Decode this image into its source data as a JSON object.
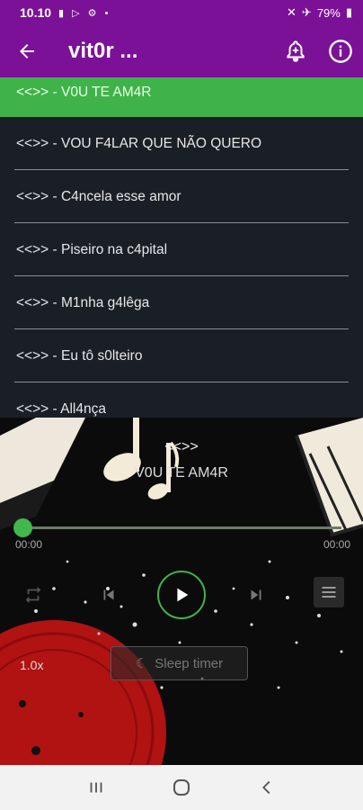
{
  "status": {
    "time": "10.10",
    "battery": "79%"
  },
  "app_bar": {
    "title": "vit0r ..."
  },
  "songs": [
    {
      "label": "<<>> - V0U TE AM4R",
      "active": true
    },
    {
      "label": "<<>> - VOU F4LAR QUE NÃO QUERO"
    },
    {
      "label": "<<>> - C4ncela esse amor"
    },
    {
      "label": "<<>> - Piseiro na c4pital"
    },
    {
      "label": "<<>> - M1nha g4lêga"
    },
    {
      "label": "<<>> - Eu tô s0lteiro"
    },
    {
      "label": "<<>> - All4nça"
    }
  ],
  "player": {
    "artist": "<<>>",
    "title": "V0U TE AM4R",
    "time_current": "00:00",
    "time_total": "00:00",
    "progress": 0,
    "speed": "1.0x",
    "sleep_timer": "Sleep timer"
  },
  "colors": {
    "accent": "#7b1196",
    "green": "#3fb34a",
    "list_bg": "#1a1f26"
  }
}
